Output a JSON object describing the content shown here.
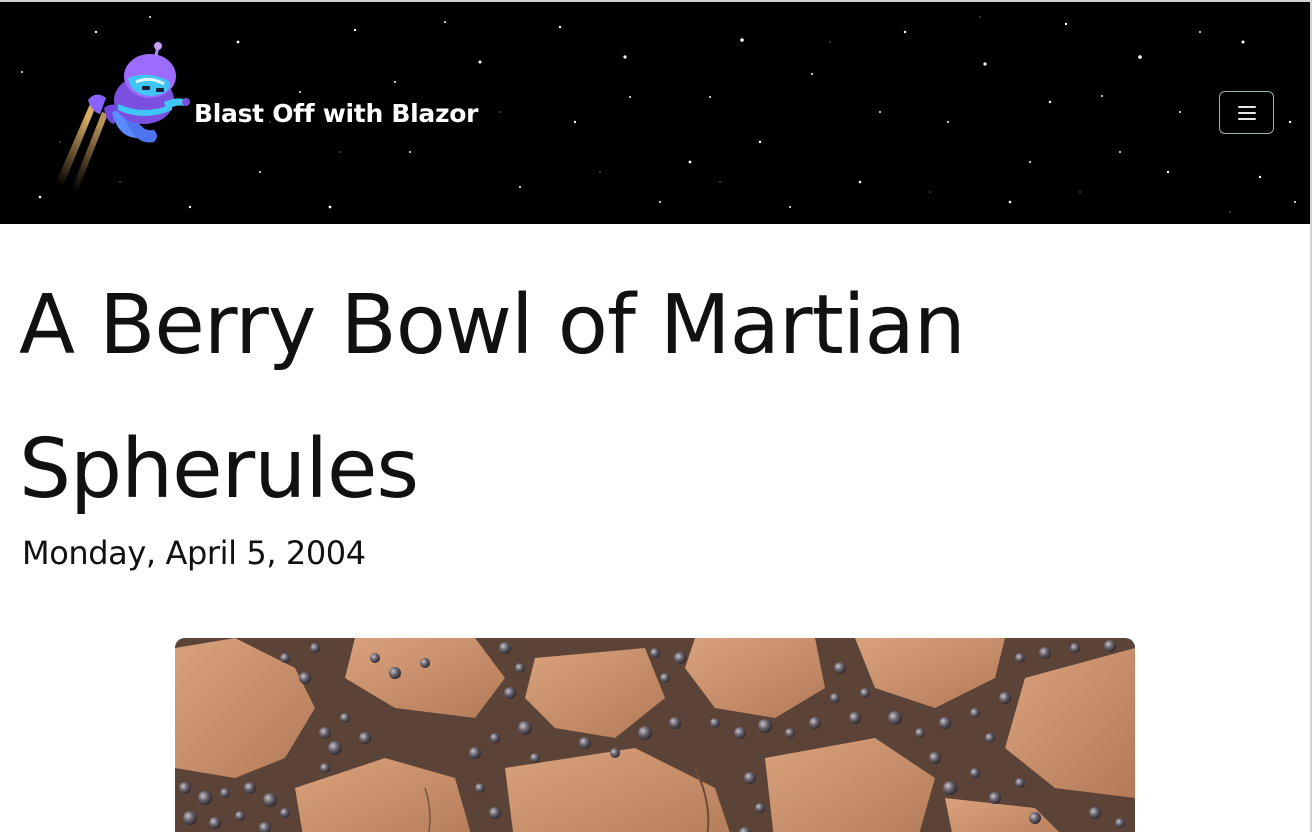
{
  "header": {
    "brand_title": "Blast Off with Blazor",
    "logo_icon": "blazor-rocket-mascot-icon",
    "menu_icon": "hamburger-menu-icon",
    "colors": {
      "background": "#000000",
      "menu_border": "#8fb7a5",
      "mascot_body": "#7b4fe0",
      "mascot_visor": "#3fc6f4"
    }
  },
  "article": {
    "title": "A Berry Bowl of Martian Spherules",
    "date": "Monday, April 5, 2004"
  }
}
